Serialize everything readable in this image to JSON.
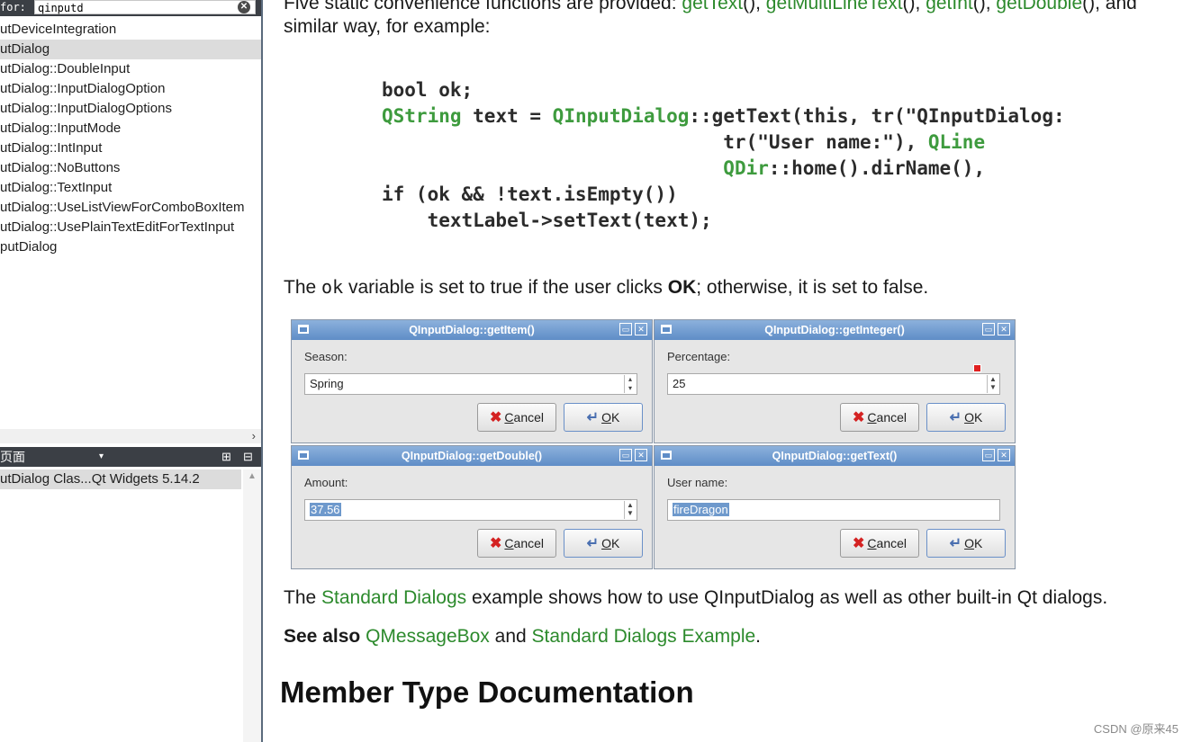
{
  "sidebar": {
    "search_prefix": "for:",
    "search_value": "qinputd",
    "clear_glyph": "✕",
    "items": [
      {
        "label": "utDeviceIntegration",
        "selected": false
      },
      {
        "label": "utDialog",
        "selected": true
      },
      {
        "label": "utDialog::DoubleInput",
        "selected": false
      },
      {
        "label": "utDialog::InputDialogOption",
        "selected": false
      },
      {
        "label": "utDialog::InputDialogOptions",
        "selected": false
      },
      {
        "label": "utDialog::InputMode",
        "selected": false
      },
      {
        "label": "utDialog::IntInput",
        "selected": false
      },
      {
        "label": "utDialog::NoButtons",
        "selected": false
      },
      {
        "label": "utDialog::TextInput",
        "selected": false
      },
      {
        "label": "utDialog::UseListViewForComboBoxItem",
        "selected": false
      },
      {
        "label": "utDialog::UsePlainTextEditForTextInput",
        "selected": false
      },
      {
        "label": "putDialog",
        "selected": false
      }
    ],
    "scroll_right_glyph": "›",
    "bookmarks": {
      "title": "页面",
      "dropdown_glyph": "▾",
      "icon1_glyph": "⊞",
      "icon2_glyph": "⊟",
      "items": [
        "utDialog Clas...Qt Widgets 5.14.2"
      ],
      "scroll_up_glyph": "▲"
    }
  },
  "doc": {
    "intro_text": "Five static convenience functions are provided: ",
    "intro_links": [
      "getText",
      "getMultiLineText",
      "getInt",
      "getDouble"
    ],
    "intro_line2": "similar way, for example:",
    "code": {
      "l1": "bool ok;",
      "l2a": "QString",
      "l2b": " text = ",
      "l2c": "QInputDialog",
      "l2d": "::getText(this, tr(\"QInputDialog:",
      "l3a": "                              tr(\"User name:\"), ",
      "l3b": "QLine",
      "l4a": "QDir",
      "l4b": "::home().dirName(),",
      "l5": "if (ok && !text.isEmpty())",
      "l6": "    textLabel->setText(text);"
    },
    "ok_pre": "The ",
    "ok_mono": "ok",
    "ok_mid": " variable is set to true if the user clicks ",
    "ok_bold": "OK",
    "ok_post": "; otherwise, it is set to false.",
    "dialogs": {
      "item": {
        "title": "QInputDialog::getItem()",
        "label": "Season:",
        "value": "Spring"
      },
      "integer": {
        "title": "QInputDialog::getInteger()",
        "label": "Percentage:",
        "value": "25"
      },
      "double": {
        "title": "QInputDialog::getDouble()",
        "label": "Amount:",
        "value": "37.56"
      },
      "text": {
        "title": "QInputDialog::getText()",
        "label": "User name:",
        "value": "fireDragon"
      },
      "cancel_first": "C",
      "cancel_rest": "ancel",
      "ok_first": "O",
      "ok_rest": "K"
    },
    "std_pre": "The ",
    "std_link": "Standard Dialogs",
    "std_post": " example shows how to use QInputDialog as well as other built-in Qt dialogs.",
    "see_also": "See also",
    "see_link1": "QMessageBox",
    "see_and": " and ",
    "see_link2": "Standard Dialogs Example",
    "see_end": ".",
    "member_title": "Member Type Documentation"
  },
  "watermark": "CSDN @原来45",
  "colors": {
    "link": "#2c8a2c",
    "titlebar": "#5f8dc7",
    "selection": "#dcdcdc"
  }
}
